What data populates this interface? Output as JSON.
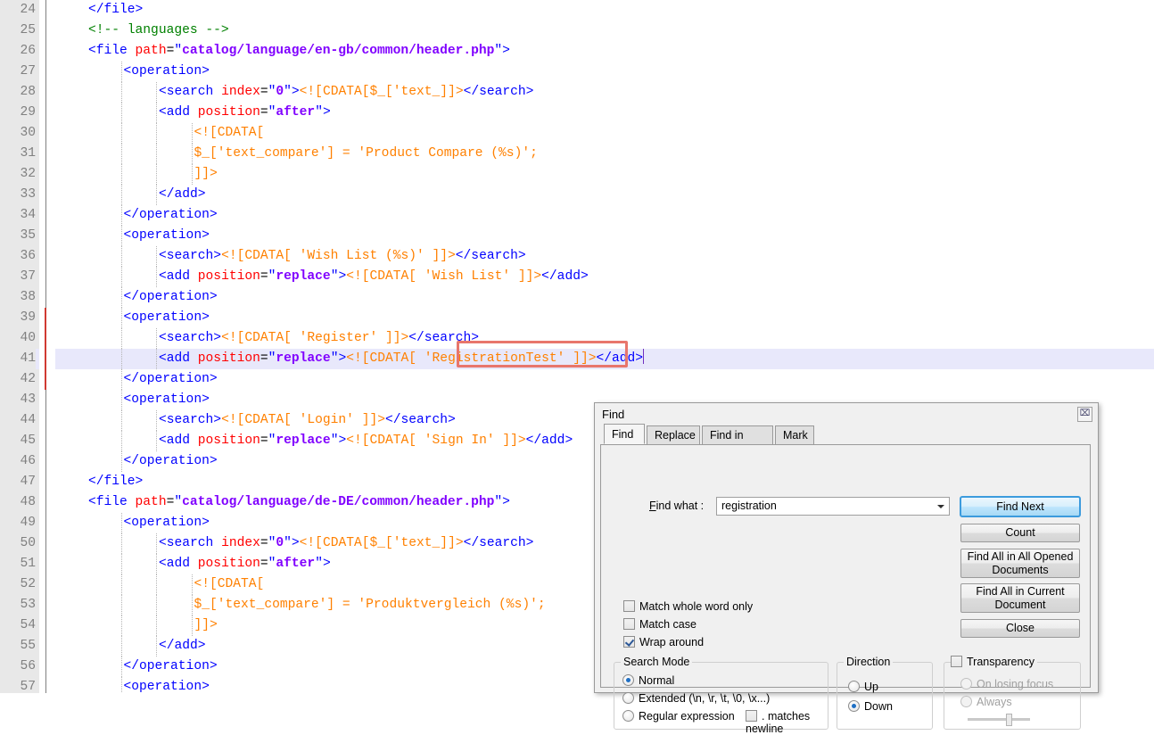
{
  "app": "Notepad++ text editor with Find dialog",
  "editor": {
    "lines": [
      {
        "num": "24",
        "indent": 0,
        "fold": "tick",
        "segs": [
          {
            "c": "tag",
            "t": "</file>"
          }
        ]
      },
      {
        "num": "25",
        "indent": 0,
        "fold": "",
        "segs": [
          {
            "c": "comment",
            "t": "<!-- languages -->"
          }
        ]
      },
      {
        "num": "26",
        "indent": 0,
        "fold": "box",
        "segs": [
          {
            "c": "tag",
            "t": "<file "
          },
          {
            "c": "attr",
            "t": "path"
          },
          {
            "c": "plain",
            "t": "="
          },
          {
            "c": "tag",
            "t": "\""
          },
          {
            "c": "val",
            "t": "catalog/language/en-gb/common/header.php"
          },
          {
            "c": "tag",
            "t": "\">"
          }
        ]
      },
      {
        "num": "27",
        "indent": 1,
        "fold": "box",
        "segs": [
          {
            "c": "tag",
            "t": "<operation>"
          }
        ]
      },
      {
        "num": "28",
        "indent": 2,
        "fold": "",
        "segs": [
          {
            "c": "tag",
            "t": "<search "
          },
          {
            "c": "attr",
            "t": "index"
          },
          {
            "c": "plain",
            "t": "="
          },
          {
            "c": "tag",
            "t": "\""
          },
          {
            "c": "val",
            "t": "0"
          },
          {
            "c": "tag",
            "t": "\">"
          },
          {
            "c": "cdata",
            "t": "<![CDATA[$_['text_]]>"
          },
          {
            "c": "tag",
            "t": "</search>"
          }
        ]
      },
      {
        "num": "29",
        "indent": 2,
        "fold": "box",
        "segs": [
          {
            "c": "tag",
            "t": "<add "
          },
          {
            "c": "attr",
            "t": "position"
          },
          {
            "c": "plain",
            "t": "="
          },
          {
            "c": "tag",
            "t": "\""
          },
          {
            "c": "val",
            "t": "after"
          },
          {
            "c": "tag",
            "t": "\">"
          }
        ]
      },
      {
        "num": "30",
        "indent": 3,
        "fold": "box",
        "segs": [
          {
            "c": "cdata",
            "t": "<![CDATA["
          }
        ]
      },
      {
        "num": "31",
        "indent": 3,
        "fold": "",
        "segs": [
          {
            "c": "cdata",
            "t": "$_['text_compare'] = 'Product Compare (%s)';"
          }
        ]
      },
      {
        "num": "32",
        "indent": 3,
        "fold": "tick",
        "segs": [
          {
            "c": "cdata",
            "t": "]]>"
          }
        ]
      },
      {
        "num": "33",
        "indent": 2,
        "fold": "tick",
        "segs": [
          {
            "c": "tag",
            "t": "</add>"
          }
        ]
      },
      {
        "num": "34",
        "indent": 1,
        "fold": "tick",
        "segs": [
          {
            "c": "tag",
            "t": "</operation>"
          }
        ]
      },
      {
        "num": "35",
        "indent": 1,
        "fold": "box",
        "segs": [
          {
            "c": "tag",
            "t": "<operation>"
          }
        ]
      },
      {
        "num": "36",
        "indent": 2,
        "fold": "",
        "segs": [
          {
            "c": "tag",
            "t": "<search>"
          },
          {
            "c": "cdata",
            "t": "<![CDATA[ 'Wish List (%s)' ]]>"
          },
          {
            "c": "tag",
            "t": "</search>"
          }
        ]
      },
      {
        "num": "37",
        "indent": 2,
        "fold": "",
        "segs": [
          {
            "c": "tag",
            "t": "<add "
          },
          {
            "c": "attr",
            "t": "position"
          },
          {
            "c": "plain",
            "t": "="
          },
          {
            "c": "tag",
            "t": "\""
          },
          {
            "c": "val",
            "t": "replace"
          },
          {
            "c": "tag",
            "t": "\">"
          },
          {
            "c": "cdata",
            "t": "<![CDATA[ 'Wish List' ]]>"
          },
          {
            "c": "tag",
            "t": "</add>"
          }
        ]
      },
      {
        "num": "38",
        "indent": 1,
        "fold": "tick",
        "segs": [
          {
            "c": "tag",
            "t": "</operation>"
          }
        ]
      },
      {
        "num": "39",
        "indent": 1,
        "fold": "box-red",
        "segs": [
          {
            "c": "tag",
            "t": "<operation>"
          }
        ]
      },
      {
        "num": "40",
        "indent": 2,
        "fold": "line-red",
        "segs": [
          {
            "c": "tag",
            "t": "<search>"
          },
          {
            "c": "cdata",
            "t": "<![CDATA[ 'Register' ]]>"
          },
          {
            "c": "tag",
            "t": "</search>"
          }
        ]
      },
      {
        "num": "41",
        "indent": 2,
        "fold": "line-red",
        "current": true,
        "segs": [
          {
            "c": "tag",
            "t": "<add "
          },
          {
            "c": "attr",
            "t": "position"
          },
          {
            "c": "plain",
            "t": "="
          },
          {
            "c": "tag",
            "t": "\""
          },
          {
            "c": "val",
            "t": "replace"
          },
          {
            "c": "tag",
            "t": "\">"
          },
          {
            "c": "cdata",
            "t": "<![CDATA[ 'RegistrationTest' ]]>"
          },
          {
            "c": "tag",
            "t": "</add>"
          },
          {
            "c": "caret",
            "t": ""
          }
        ]
      },
      {
        "num": "42",
        "indent": 1,
        "fold": "tick-red",
        "segs": [
          {
            "c": "tag",
            "t": "</operation>"
          }
        ]
      },
      {
        "num": "43",
        "indent": 1,
        "fold": "box",
        "segs": [
          {
            "c": "tag",
            "t": "<operation>"
          }
        ]
      },
      {
        "num": "44",
        "indent": 2,
        "fold": "",
        "segs": [
          {
            "c": "tag",
            "t": "<search>"
          },
          {
            "c": "cdata",
            "t": "<![CDATA[ 'Login' ]]>"
          },
          {
            "c": "tag",
            "t": "</search>"
          }
        ]
      },
      {
        "num": "45",
        "indent": 2,
        "fold": "",
        "segs": [
          {
            "c": "tag",
            "t": "<add "
          },
          {
            "c": "attr",
            "t": "position"
          },
          {
            "c": "plain",
            "t": "="
          },
          {
            "c": "tag",
            "t": "\""
          },
          {
            "c": "val",
            "t": "replace"
          },
          {
            "c": "tag",
            "t": "\">"
          },
          {
            "c": "cdata",
            "t": "<![CDATA[ 'Sign In' ]]>"
          },
          {
            "c": "tag",
            "t": "</add>"
          }
        ]
      },
      {
        "num": "46",
        "indent": 1,
        "fold": "tick",
        "segs": [
          {
            "c": "tag",
            "t": "</operation>"
          }
        ]
      },
      {
        "num": "47",
        "indent": 0,
        "fold": "tick",
        "segs": [
          {
            "c": "tag",
            "t": "</file>"
          }
        ]
      },
      {
        "num": "48",
        "indent": 0,
        "fold": "box",
        "segs": [
          {
            "c": "tag",
            "t": "<file "
          },
          {
            "c": "attr",
            "t": "path"
          },
          {
            "c": "plain",
            "t": "="
          },
          {
            "c": "tag",
            "t": "\""
          },
          {
            "c": "val",
            "t": "catalog/language/de-DE/common/header.php"
          },
          {
            "c": "tag",
            "t": "\">"
          }
        ]
      },
      {
        "num": "49",
        "indent": 1,
        "fold": "box",
        "segs": [
          {
            "c": "tag",
            "t": "<operation>"
          }
        ]
      },
      {
        "num": "50",
        "indent": 2,
        "fold": "",
        "segs": [
          {
            "c": "tag",
            "t": "<search "
          },
          {
            "c": "attr",
            "t": "index"
          },
          {
            "c": "plain",
            "t": "="
          },
          {
            "c": "tag",
            "t": "\""
          },
          {
            "c": "val",
            "t": "0"
          },
          {
            "c": "tag",
            "t": "\">"
          },
          {
            "c": "cdata",
            "t": "<![CDATA[$_['text_]]>"
          },
          {
            "c": "tag",
            "t": "</search>"
          }
        ]
      },
      {
        "num": "51",
        "indent": 2,
        "fold": "box",
        "segs": [
          {
            "c": "tag",
            "t": "<add "
          },
          {
            "c": "attr",
            "t": "position"
          },
          {
            "c": "plain",
            "t": "="
          },
          {
            "c": "tag",
            "t": "\""
          },
          {
            "c": "val",
            "t": "after"
          },
          {
            "c": "tag",
            "t": "\">"
          }
        ]
      },
      {
        "num": "52",
        "indent": 3,
        "fold": "box",
        "segs": [
          {
            "c": "cdata",
            "t": "<![CDATA["
          }
        ]
      },
      {
        "num": "53",
        "indent": 3,
        "fold": "",
        "segs": [
          {
            "c": "cdata",
            "t": "$_['text_compare'] = 'Produktvergleich (%s)';"
          }
        ]
      },
      {
        "num": "54",
        "indent": 3,
        "fold": "tick",
        "segs": [
          {
            "c": "cdata",
            "t": "]]>"
          }
        ]
      },
      {
        "num": "55",
        "indent": 2,
        "fold": "tick",
        "segs": [
          {
            "c": "tag",
            "t": "</add>"
          }
        ]
      },
      {
        "num": "56",
        "indent": 1,
        "fold": "tick",
        "segs": [
          {
            "c": "tag",
            "t": "</operation>"
          }
        ]
      },
      {
        "num": "57",
        "indent": 1,
        "fold": "box",
        "segs": [
          {
            "c": "tag",
            "t": "<operation>"
          }
        ]
      }
    ],
    "search_match_text": "'RegistrationTest'"
  },
  "find_dialog": {
    "title": "Find",
    "close_label": "⌧",
    "tabs": [
      {
        "label": "Find",
        "active": true
      },
      {
        "label": "Replace",
        "active": false
      },
      {
        "label": "Find in Files",
        "active": false
      },
      {
        "label": "Mark",
        "active": false
      }
    ],
    "find_what_label": "Find what :",
    "find_what_value": "registration",
    "buttons": [
      {
        "id": "find-next",
        "label": "Find Next",
        "default": true
      },
      {
        "id": "count",
        "label": "Count",
        "default": false
      },
      {
        "id": "find-all-opened",
        "label": "Find All in All Opened Documents",
        "default": false
      },
      {
        "id": "find-all-current",
        "label": "Find All in Current Document",
        "default": false
      },
      {
        "id": "close",
        "label": "Close",
        "default": false
      }
    ],
    "options": [
      {
        "id": "match-whole-word",
        "label": "Match whole word only",
        "checked": false
      },
      {
        "id": "match-case",
        "label": "Match case",
        "checked": false
      },
      {
        "id": "wrap-around",
        "label": "Wrap around",
        "checked": true
      }
    ],
    "search_mode": {
      "title": "Search Mode",
      "items": [
        {
          "id": "normal",
          "label": "Normal",
          "selected": true
        },
        {
          "id": "extended",
          "label": "Extended (\\n, \\r, \\t, \\0, \\x...)",
          "selected": false
        },
        {
          "id": "regex",
          "label": "Regular expression",
          "selected": false
        }
      ],
      "dot_matches_newline": {
        "label": ". matches newline",
        "checked": false
      }
    },
    "direction": {
      "title": "Direction",
      "items": [
        {
          "id": "up",
          "label": "Up",
          "selected": false
        },
        {
          "id": "down",
          "label": "Down",
          "selected": true
        }
      ]
    },
    "transparency": {
      "title": "Transparency",
      "enabled": false,
      "items": [
        {
          "id": "on-losing-focus",
          "label": "On losing focus",
          "selected": false
        },
        {
          "id": "always",
          "label": "Always",
          "selected": false
        }
      ],
      "slider_value": 50
    }
  },
  "colors": {
    "tag": "#0000ff",
    "attribute": "#ff0000",
    "attribute_value": "#8000ff",
    "cdata": "#ff8000",
    "comment": "#008000",
    "current_line_bg": "#e8e8fb",
    "match_outline": "#e8766c",
    "gutter_bg": "#e8e8e8",
    "accent": "#3c9bdd"
  }
}
